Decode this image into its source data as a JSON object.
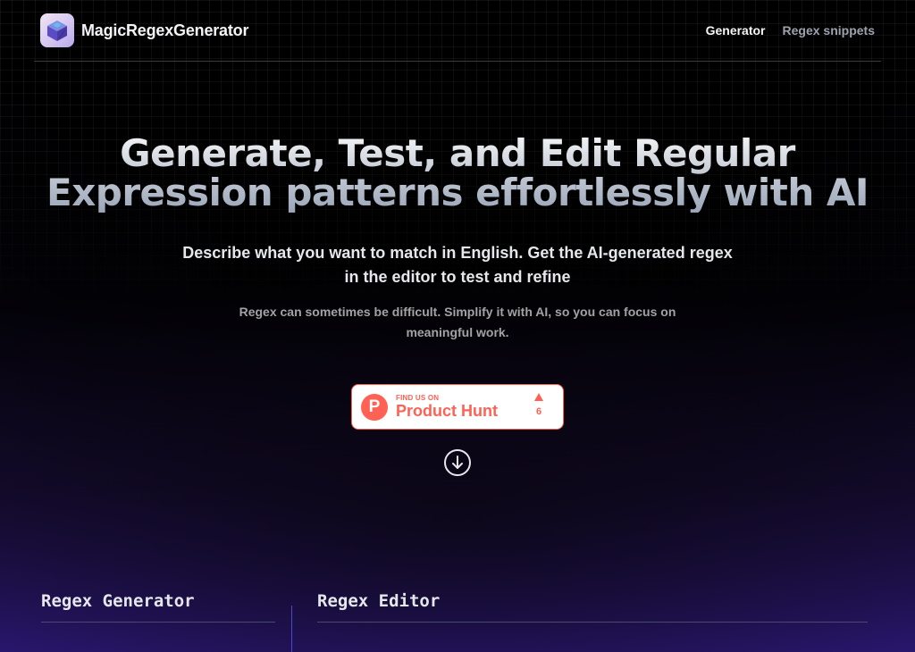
{
  "header": {
    "brand_name": "MagicRegexGenerator",
    "logo_icon": "cube-logo-icon",
    "nav": [
      {
        "label": "Generator",
        "active": true
      },
      {
        "label": "Regex snippets",
        "active": false
      }
    ]
  },
  "hero": {
    "title_line1": "Generate, Test, and Edit Regular",
    "title_line2": "Expression patterns effortlessly with AI",
    "subtitle": "Describe what you want to match in English. Get the AI-generated regex in the editor to test and refine",
    "description": "Regex can sometimes be difficult. Simplify it with AI, so you can focus on meaningful work."
  },
  "product_hunt": {
    "small_label": "FIND US ON",
    "big_label": "Product Hunt",
    "logo_letter": "P",
    "votes": "6",
    "color": "#ff6154"
  },
  "scroll_icon": "arrow-down-circle-icon",
  "sections": {
    "generator_title": "Regex Generator",
    "editor_title": "Regex Editor"
  },
  "colors": {
    "accent_divider": "#4f46c8",
    "bottom_purple": "#2a1770"
  }
}
